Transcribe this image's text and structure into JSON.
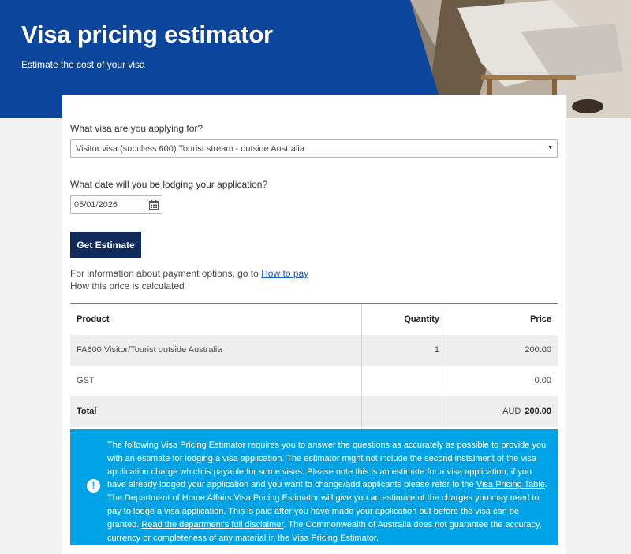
{
  "hero": {
    "title": "Visa pricing estimator",
    "subtitle": "Estimate the cost of your visa"
  },
  "form": {
    "visa_question": "What visa are you applying for?",
    "visa_selected": "Visitor visa (subclass 600) Tourist stream - outside Australia",
    "date_question": "What date will you be lodging your application?",
    "date_value": "05/01/2026",
    "submit_label": "Get Estimate"
  },
  "info": {
    "payment_prefix": "For information about payment options, go to ",
    "payment_link": "How to pay",
    "calc_text": "How this price is calculated"
  },
  "table": {
    "headers": {
      "product": "Product",
      "quantity": "Quantity",
      "price": "Price"
    },
    "rows": [
      {
        "product": "FA600 Visitor/Tourist outside Australia",
        "quantity": "1",
        "price": "200.00"
      },
      {
        "product": "GST",
        "quantity": "",
        "price": "0.00"
      }
    ],
    "total": {
      "label": "Total",
      "currency": "AUD",
      "amount": "200.00"
    }
  },
  "notice": {
    "icon": "exclamation",
    "text_1": "The following Visa Pricing Estimator requires you to answer the questions as accurately as possible to provide you with an estimate for lodging a visa application. The estimator might not include the second instalment of the visa application charge which is payable for some visas. Please note this is an estimate for a visa application, if you have already lodged your application and you want to change/add applicants please refer to the ",
    "link_1": "Visa Pricing Table",
    "text_2": ". The Department of Home Affairs Visa Pricing Estimator will give you an estimate of the charges you may need to pay to lodge a visa application. This is paid after you have made your application but before the visa can be granted. ",
    "link_2": "Read the department's full disclaimer",
    "text_3": ". The Commonwealth of Australia does not guarantee the accuracy, currency or completeness of any material in the Visa Pricing Estimator."
  },
  "colors": {
    "hero_blue": "#0c469c",
    "button_navy": "#0f2a5b",
    "notice_blue": "#00a4e6",
    "link_blue": "#1a5ec7"
  }
}
